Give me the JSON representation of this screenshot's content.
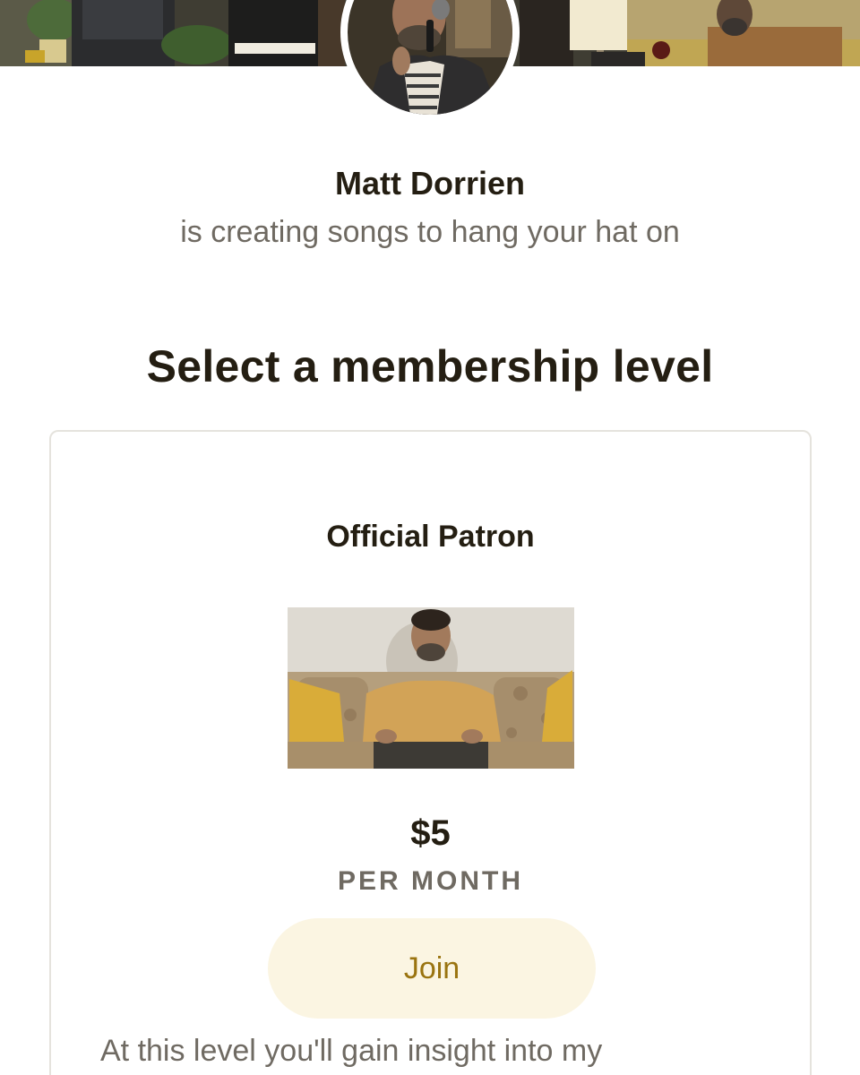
{
  "creator": {
    "name": "Matt Dorrien",
    "tagline": "is creating songs to hang your hat on"
  },
  "membership": {
    "heading": "Select a membership level",
    "tiers": [
      {
        "title": "Official Patron",
        "price": "$5",
        "period": "PER MONTH",
        "join_label": "Join",
        "description": "At this level you'll gain insight into my"
      }
    ]
  },
  "colors": {
    "text_primary": "#241e12",
    "text_secondary": "#6f6a62",
    "join_bg": "#fbf5e2",
    "join_text": "#9a7410",
    "card_border": "#e5e3dd"
  }
}
